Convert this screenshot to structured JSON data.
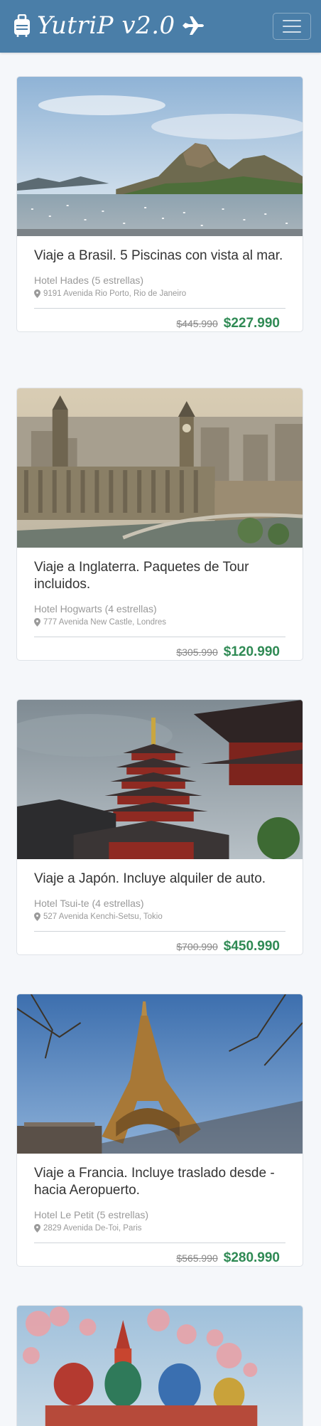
{
  "navbar": {
    "brand": "YutriP v2.0",
    "brand_left_icon": "suitcase-icon",
    "brand_right_icon": "airplane-icon",
    "menu_icon": "hamburger-menu-icon"
  },
  "cards": [
    {
      "title": "Viaje a Brasil. 5 Piscinas con vista al mar.",
      "hotel": "Hotel Hades (5 estrellas)",
      "address": "9191 Avenida Rio Porto, Rio de Janeiro",
      "old_price": "$445.990",
      "new_price": "$227.990"
    },
    {
      "title": "Viaje a Inglaterra. Paquetes de Tour incluidos.",
      "hotel": "Hotel Hogwarts (4 estrellas)",
      "address": "777 Avenida New Castle, Londres",
      "old_price": "$305.990",
      "new_price": "$120.990"
    },
    {
      "title": "Viaje a Japón. Incluye alquiler de auto.",
      "hotel": "Hotel Tsui-te (4 estrellas)",
      "address": "527 Avenida Kenchi-Setsu, Tokio",
      "old_price": "$700.990",
      "new_price": "$450.990"
    },
    {
      "title": "Viaje a Francia. Incluye traslado desde - hacia Aeropuerto.",
      "hotel": "Hotel Le Petit (5 estrellas)",
      "address": "2829 Avenida De-Toi, Paris",
      "old_price": "$565.990",
      "new_price": "$280.990"
    }
  ],
  "colors": {
    "navbar": "#4a7ea8",
    "price": "#2f8a54"
  }
}
